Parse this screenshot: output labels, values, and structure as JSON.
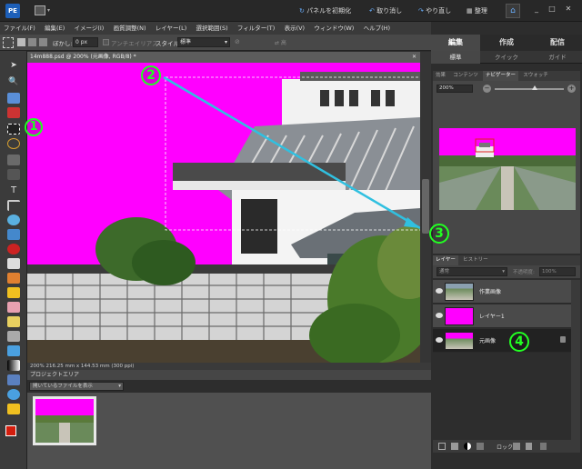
{
  "titlebar": {
    "reset_panels": "パネルを初期化",
    "undo": "取り消し",
    "redo": "やり直し",
    "organize": "整理"
  },
  "menu": [
    "ファイル(F)",
    "編集(E)",
    "イメージ(I)",
    "画質調整(N)",
    "レイヤー(L)",
    "選択範囲(S)",
    "フィルター(T)",
    "表示(V)",
    "ウィンドウ(W)",
    "ヘルプ(H)"
  ],
  "options": {
    "feather_label": "ぼかし:",
    "feather_value": "0 px",
    "antialias_label": "アンチエイリアス",
    "style_label": "スタイル:",
    "style_value": "標準"
  },
  "document": {
    "tab_title": "14m888.psd @ 200% (元画像, RGB/8) *",
    "status": "200%     216.25 mm x 144.53 mm (300 ppi)"
  },
  "project": {
    "title": "プロジェクトエリア",
    "filter": "開いているファイルを表示"
  },
  "mode_tabs": [
    "編集",
    "作成",
    "配信"
  ],
  "sub_tabs": [
    "標準",
    "クイック",
    "ガイド"
  ],
  "nav_tabs": [
    "効果",
    "コンテンツ",
    "ナビゲーター",
    "スウォッチ"
  ],
  "zoom_value": "200%",
  "layers_tabs": [
    "レイヤー",
    "ヒストリー"
  ],
  "layers_opts": {
    "blend": "通常",
    "opacity_label": "不透明度:",
    "opacity_value": "100%"
  },
  "layers": [
    {
      "name": "作業画像"
    },
    {
      "name": "レイヤー1"
    },
    {
      "name": "元画像"
    }
  ],
  "layer_bottom": {
    "lock_label": "ロック"
  },
  "annotations": [
    "1",
    "2",
    "3",
    "4"
  ],
  "colors": {
    "accent": "#ff00ff",
    "annotation": "#22ff22",
    "arrow": "#30c0e0"
  }
}
